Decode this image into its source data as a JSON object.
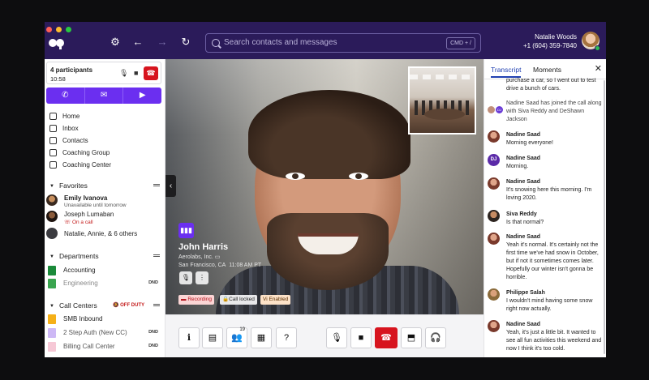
{
  "window": {
    "traffic_lights": [
      "#ff5f57",
      "#febc2e",
      "#28c840"
    ]
  },
  "topbar": {
    "search_placeholder": "Search contacts and messages",
    "search_shortcut": "CMD + /",
    "user_name": "Natalie Woods",
    "user_phone": "+1 (604) 359-7840"
  },
  "call_card": {
    "participants": "4 participants",
    "duration": "10:58"
  },
  "nav": {
    "items": [
      "Home",
      "Inbox",
      "Contacts",
      "Coaching Group",
      "Coaching Center"
    ]
  },
  "favorites": {
    "title": "Favorites",
    "items": [
      {
        "name": "Emily Ivanova",
        "status": "Unavailable until tomorrow"
      },
      {
        "name": "Joseph Lumaban",
        "status": "On a call"
      },
      {
        "name": "Natalie, Annie, & 6 others",
        "status": ""
      }
    ]
  },
  "departments": {
    "title": "Departments",
    "items": [
      {
        "label": "Accounting",
        "dnd": "",
        "color": "#1b8a3a"
      },
      {
        "label": "Engineering",
        "dnd": "DND",
        "color": "#3aa550"
      }
    ]
  },
  "call_centers": {
    "title": "Call Centers",
    "off_duty": "OFF DUTY",
    "items": [
      {
        "label": "SMB Inbound",
        "dnd": "",
        "color": "#f5b018"
      },
      {
        "label": "2 Step Auth (New CC)",
        "dnd": "DND",
        "color": "#cdb8f5"
      },
      {
        "label": "Billing Call Center",
        "dnd": "DND",
        "color": "#f6c8d6"
      }
    ]
  },
  "video": {
    "caller_name": "John Harris",
    "caller_company": "Aerolabs, Inc.",
    "caller_location": "San Francisco, CA",
    "caller_time": "11:08 AM PT",
    "chips": [
      "Recording",
      "Call locked",
      "Vi  Enabled"
    ]
  },
  "controls": {
    "participants_count": "19"
  },
  "transcript": {
    "tabs": [
      "Transcript",
      "Moments"
    ],
    "messages": [
      {
        "who": "",
        "text": "purchase a car, so I went out to test drive a bunch of cars.",
        "type": "cont"
      },
      {
        "who": "",
        "text": "Nadine Saad has joined the call along with Siva Reddy and DeShawn Jackson",
        "type": "sys"
      },
      {
        "who": "Nadine Saad",
        "text": "Morning everyone!"
      },
      {
        "who": "Nadine Saad",
        "text": "Morning.",
        "initials": "DJ"
      },
      {
        "who": "Nadine Saad",
        "text": "It's snowing here this morning. I'm loving 2020."
      },
      {
        "who": "Siva Reddy",
        "text": "Is that normal?"
      },
      {
        "who": "Nadine Saad",
        "text": "Yeah it's normal. It's certainly not the first time we've had snow in October, but if not it sometimes comes later. Hopefully our winter isn't gonna be horrible."
      },
      {
        "who": "Philippe Salah",
        "text": "I wouldn't mind having some snow right now actually."
      },
      {
        "who": "Nadine Saad",
        "text": "Yeah, it's just a little bit. It wanted to see all fun activities this weekend and now I think it's too cold."
      }
    ]
  }
}
